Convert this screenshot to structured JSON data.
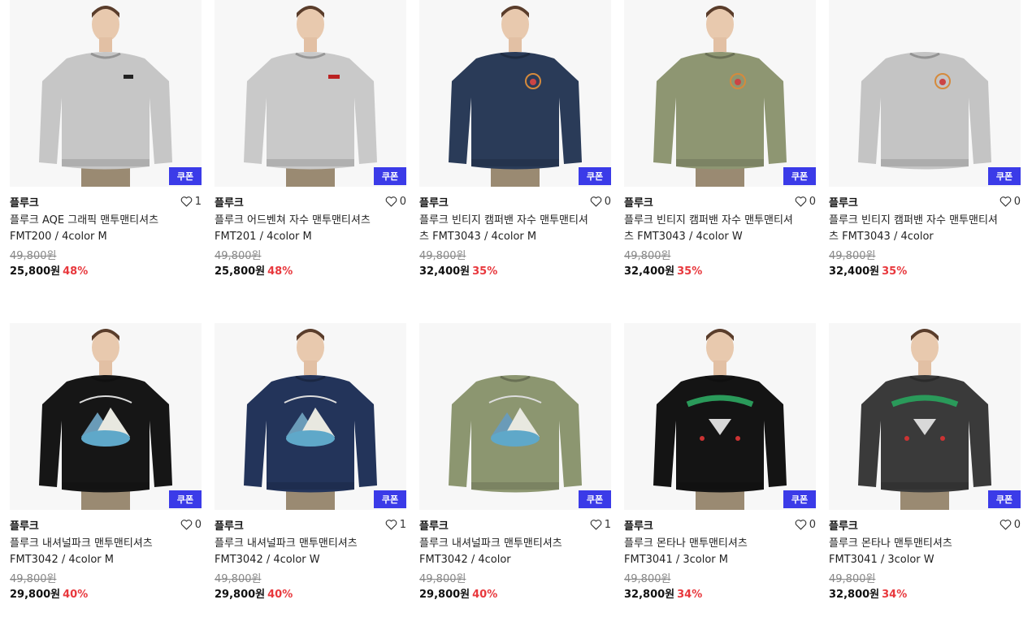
{
  "coupon_label": "쿠폰",
  "colors": {
    "coupon": "#3b3be8",
    "discount": "#e8383d"
  },
  "products": [
    {
      "brand": "플루크",
      "likes": "1",
      "name": "플루크 AQE 그래픽 맨투맨티셔츠 FMT200 / 4color M",
      "original_price": "49,800원",
      "price": "25,800원",
      "discount": "48%",
      "shirt_color": "#c6c6c6",
      "model": true,
      "print": "logo-black"
    },
    {
      "brand": "플루크",
      "likes": "0",
      "name": "플루크 어드벤쳐 자수 맨투맨티셔츠 FMT201 / 4color M",
      "original_price": "49,800원",
      "price": "25,800원",
      "discount": "48%",
      "shirt_color": "#c9c9c9",
      "model": true,
      "print": "logo-red"
    },
    {
      "brand": "플루크",
      "likes": "0",
      "name": "플루크 빈티지 캠퍼밴 자수 맨투맨티셔츠 FMT3043 / 4color M",
      "original_price": "49,800원",
      "price": "32,400원",
      "discount": "35%",
      "shirt_color": "#2a3b58",
      "model": true,
      "print": "badge"
    },
    {
      "brand": "플루크",
      "likes": "0",
      "name": "플루크 빈티지 캠퍼밴 자수 맨투맨티셔츠 FMT3043 / 4color W",
      "original_price": "49,800원",
      "price": "32,400원",
      "discount": "35%",
      "shirt_color": "#8e9672",
      "model": true,
      "print": "badge"
    },
    {
      "brand": "플루크",
      "likes": "0",
      "name": "플루크 빈티지 캠퍼밴 자수 맨투맨티셔츠 FMT3043 / 4color",
      "original_price": "49,800원",
      "price": "32,400원",
      "discount": "35%",
      "shirt_color": "#c4c4c4",
      "model": false,
      "print": "badge"
    },
    {
      "brand": "플루크",
      "likes": "0",
      "name": "플루크 내셔널파크 맨투맨티셔츠 FMT3042 / 4color M",
      "original_price": "49,800원",
      "price": "29,800원",
      "discount": "40%",
      "shirt_color": "#161616",
      "model": true,
      "print": "park"
    },
    {
      "brand": "플루크",
      "likes": "1",
      "name": "플루크 내셔널파크 맨투맨티셔츠 FMT3042 / 4color W",
      "original_price": "49,800원",
      "price": "29,800원",
      "discount": "40%",
      "shirt_color": "#23345a",
      "model": true,
      "print": "park"
    },
    {
      "brand": "플루크",
      "likes": "1",
      "name": "플루크 내셔널파크 맨투맨티셔츠 FMT3042 / 4color",
      "original_price": "49,800원",
      "price": "29,800원",
      "discount": "40%",
      "shirt_color": "#8c9670",
      "model": false,
      "print": "park"
    },
    {
      "brand": "플루크",
      "likes": "0",
      "name": "플루크 몬타나 맨투맨티셔츠 FMT3041 / 3color M",
      "original_price": "49,800원",
      "price": "32,800원",
      "discount": "34%",
      "shirt_color": "#141414",
      "model": true,
      "print": "montana"
    },
    {
      "brand": "플루크",
      "likes": "0",
      "name": "플루크 몬타나 맨투맨티셔츠 FMT3041 / 3color W",
      "original_price": "49,800원",
      "price": "32,800원",
      "discount": "34%",
      "shirt_color": "#3a3a3a",
      "model": true,
      "print": "montana"
    }
  ]
}
